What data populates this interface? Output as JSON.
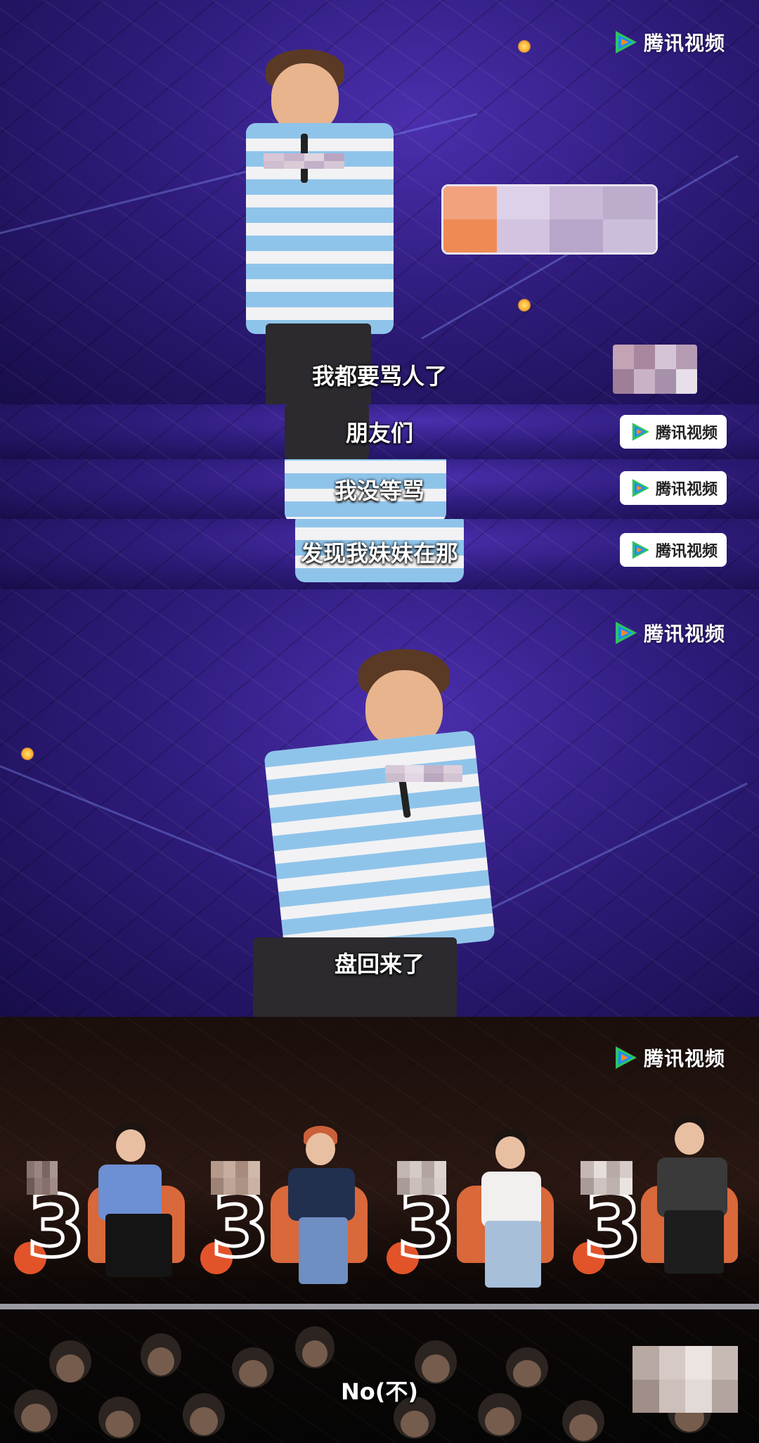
{
  "brand": {
    "logo_text": "腾讯视频",
    "logo_icon": "tencent-video-play-icon",
    "colors": {
      "play_green": "#2fc35f",
      "play_blue": "#1e8cff",
      "play_orange": "#ff8a1f"
    }
  },
  "panels": [
    {
      "subtitle": "我都要骂人了"
    },
    {
      "subtitle": "朋友们"
    },
    {
      "subtitle": "我没等骂"
    },
    {
      "subtitle": "发现我妹妹在那"
    },
    {
      "subtitle": "盘回来了"
    },
    {
      "subtitle": "No(不)"
    }
  ],
  "stage_badge": "3"
}
